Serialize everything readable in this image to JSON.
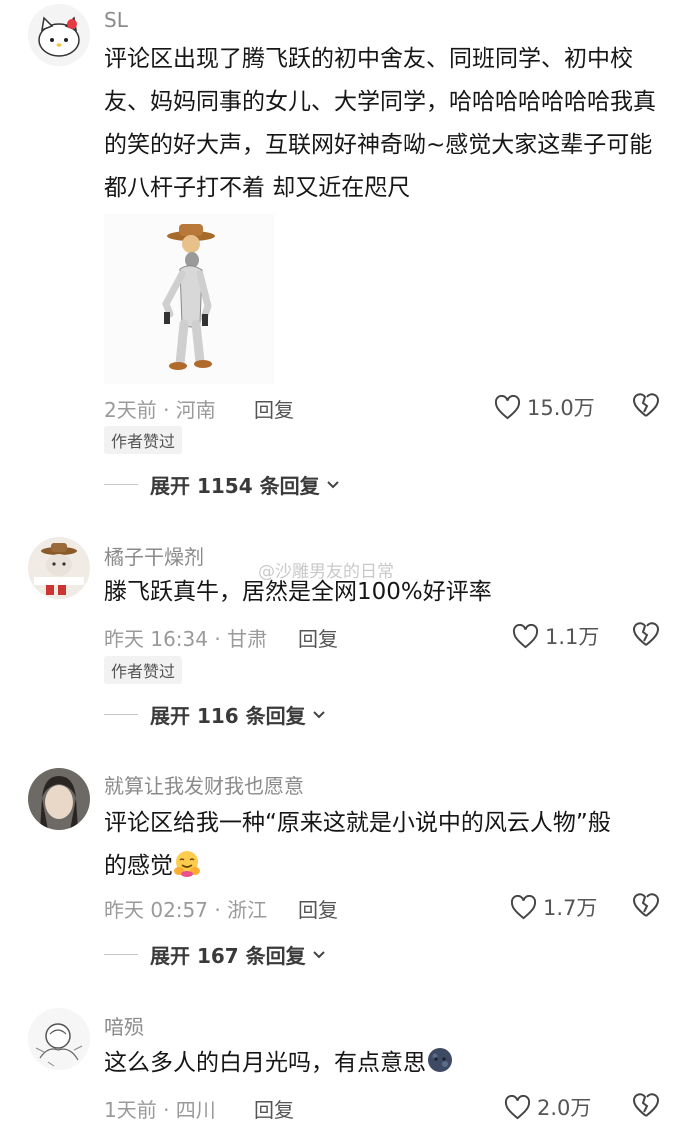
{
  "watermark": "@沙雕男友的日常",
  "colors": {
    "meta_gray": "#9a9a9a",
    "text": "#161616",
    "badge_bg": "#f2f2f2"
  },
  "comments": [
    {
      "username": "SL",
      "text": "评论区出现了腾飞跃的初中舍友、同班同学、初中校友、妈妈同事的女儿、大学同学，哈哈哈哈哈哈哈我真的笑的好大声，互联网好神奇呦~感觉大家这辈子可能都八杆子打不着 却又近在咫尺",
      "meta": "2天前 · 河南",
      "reply_label": "回复",
      "likes": "15.0万",
      "author_liked": "作者赞过",
      "expand": "展开 1154 条回复",
      "sticker": "cowboy-dancing-sticker"
    },
    {
      "username": "橘子干燥剂",
      "text": "滕飞跃真牛，居然是全网100%好评率",
      "meta": "昨天 16:34 · 甘肃",
      "reply_label": "回复",
      "likes": "1.1万",
      "author_liked": "作者赞过",
      "expand": "展开 116 条回复"
    },
    {
      "username": "就算让我发财我也愿意",
      "text_line1": "评论区给我一种“原来这就是小说中的风云人物”般",
      "text_line2": "的感觉",
      "emoji": "hugging-face-emoji",
      "meta": "昨天 02:57 · 浙江",
      "reply_label": "回复",
      "likes": "1.7万",
      "expand": "展开 167 条回复"
    },
    {
      "username": "喑殒",
      "text": "这么多人的白月光吗，有点意思",
      "emoji": "new-moon-face-emoji",
      "meta": "1天前 · 四川",
      "reply_label": "回复",
      "likes": "2.0万"
    }
  ]
}
